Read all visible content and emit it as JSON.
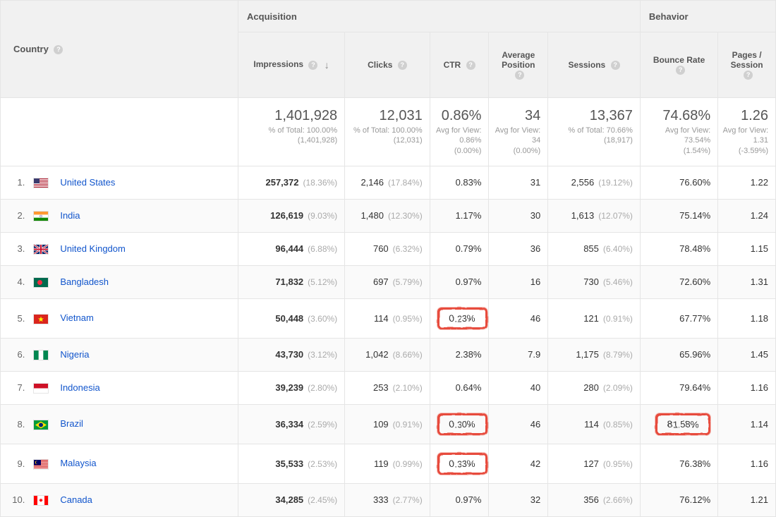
{
  "headers": {
    "country": "Country",
    "acquisition": "Acquisition",
    "behavior": "Behavior",
    "impressions": "Impressions",
    "clicks": "Clicks",
    "ctr": "CTR",
    "avgpos": "Average Position",
    "sessions": "Sessions",
    "bounce": "Bounce Rate",
    "pages": "Pages / Session"
  },
  "summary": {
    "impressions": {
      "big": "1,401,928",
      "sub1": "% of Total: 100.00%",
      "sub2": "(1,401,928)"
    },
    "clicks": {
      "big": "12,031",
      "sub1": "% of Total: 100.00%",
      "sub2": "(12,031)"
    },
    "ctr": {
      "big": "0.86%",
      "sub1": "Avg for View: 0.86%",
      "sub2": "(0.00%)"
    },
    "avgpos": {
      "big": "34",
      "sub1": "Avg for View: 34",
      "sub2": "(0.00%)"
    },
    "sessions": {
      "big": "13,367",
      "sub1": "% of Total: 70.66% (18,917)",
      "sub2": ""
    },
    "bounce": {
      "big": "74.68%",
      "sub1": "Avg for View: 73.54%",
      "sub2": "(1.54%)"
    },
    "pages": {
      "big": "1.26",
      "sub1": "Avg for View: 1.31",
      "sub2": "(-3.59%)"
    }
  },
  "rows": [
    {
      "idx": "1.",
      "country": "United States",
      "flag": "us",
      "impressions": "257,372",
      "impressions_pct": "(18.36%)",
      "clicks": "2,146",
      "clicks_pct": "(17.84%)",
      "ctr": "0.83%",
      "ctr_hl": false,
      "avgpos": "31",
      "sessions": "2,556",
      "sessions_pct": "(19.12%)",
      "bounce": "76.60%",
      "bounce_hl": false,
      "pages": "1.22"
    },
    {
      "idx": "2.",
      "country": "India",
      "flag": "in",
      "impressions": "126,619",
      "impressions_pct": "(9.03%)",
      "clicks": "1,480",
      "clicks_pct": "(12.30%)",
      "ctr": "1.17%",
      "ctr_hl": false,
      "avgpos": "30",
      "sessions": "1,613",
      "sessions_pct": "(12.07%)",
      "bounce": "75.14%",
      "bounce_hl": false,
      "pages": "1.24"
    },
    {
      "idx": "3.",
      "country": "United Kingdom",
      "flag": "gb",
      "impressions": "96,444",
      "impressions_pct": "(6.88%)",
      "clicks": "760",
      "clicks_pct": "(6.32%)",
      "ctr": "0.79%",
      "ctr_hl": false,
      "avgpos": "36",
      "sessions": "855",
      "sessions_pct": "(6.40%)",
      "bounce": "78.48%",
      "bounce_hl": false,
      "pages": "1.15"
    },
    {
      "idx": "4.",
      "country": "Bangladesh",
      "flag": "bd",
      "impressions": "71,832",
      "impressions_pct": "(5.12%)",
      "clicks": "697",
      "clicks_pct": "(5.79%)",
      "ctr": "0.97%",
      "ctr_hl": false,
      "avgpos": "16",
      "sessions": "730",
      "sessions_pct": "(5.46%)",
      "bounce": "72.60%",
      "bounce_hl": false,
      "pages": "1.31"
    },
    {
      "idx": "5.",
      "country": "Vietnam",
      "flag": "vn",
      "impressions": "50,448",
      "impressions_pct": "(3.60%)",
      "clicks": "114",
      "clicks_pct": "(0.95%)",
      "ctr": "0.23%",
      "ctr_hl": true,
      "avgpos": "46",
      "sessions": "121",
      "sessions_pct": "(0.91%)",
      "bounce": "67.77%",
      "bounce_hl": false,
      "pages": "1.18"
    },
    {
      "idx": "6.",
      "country": "Nigeria",
      "flag": "ng",
      "impressions": "43,730",
      "impressions_pct": "(3.12%)",
      "clicks": "1,042",
      "clicks_pct": "(8.66%)",
      "ctr": "2.38%",
      "ctr_hl": false,
      "avgpos": "7.9",
      "sessions": "1,175",
      "sessions_pct": "(8.79%)",
      "bounce": "65.96%",
      "bounce_hl": false,
      "pages": "1.45"
    },
    {
      "idx": "7.",
      "country": "Indonesia",
      "flag": "id",
      "impressions": "39,239",
      "impressions_pct": "(2.80%)",
      "clicks": "253",
      "clicks_pct": "(2.10%)",
      "ctr": "0.64%",
      "ctr_hl": false,
      "avgpos": "40",
      "sessions": "280",
      "sessions_pct": "(2.09%)",
      "bounce": "79.64%",
      "bounce_hl": false,
      "pages": "1.16"
    },
    {
      "idx": "8.",
      "country": "Brazil",
      "flag": "br",
      "impressions": "36,334",
      "impressions_pct": "(2.59%)",
      "clicks": "109",
      "clicks_pct": "(0.91%)",
      "ctr": "0.30%",
      "ctr_hl": true,
      "avgpos": "46",
      "sessions": "114",
      "sessions_pct": "(0.85%)",
      "bounce": "81.58%",
      "bounce_hl": true,
      "pages": "1.14"
    },
    {
      "idx": "9.",
      "country": "Malaysia",
      "flag": "my",
      "impressions": "35,533",
      "impressions_pct": "(2.53%)",
      "clicks": "119",
      "clicks_pct": "(0.99%)",
      "ctr": "0.33%",
      "ctr_hl": true,
      "avgpos": "42",
      "sessions": "127",
      "sessions_pct": "(0.95%)",
      "bounce": "76.38%",
      "bounce_hl": false,
      "pages": "1.16"
    },
    {
      "idx": "10.",
      "country": "Canada",
      "flag": "ca",
      "impressions": "34,285",
      "impressions_pct": "(2.45%)",
      "clicks": "333",
      "clicks_pct": "(2.77%)",
      "ctr": "0.97%",
      "ctr_hl": false,
      "avgpos": "32",
      "sessions": "356",
      "sessions_pct": "(2.66%)",
      "bounce": "76.12%",
      "bounce_hl": false,
      "pages": "1.21"
    }
  ]
}
